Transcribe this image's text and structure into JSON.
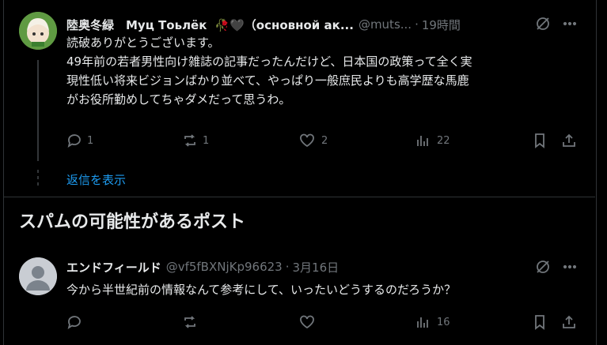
{
  "post1": {
    "display_name": "陸奥冬緑　Муц Тоьлёк",
    "emoji_suffix": "🥀🖤（основной ак...",
    "handle": "@muts...",
    "time": "19時間",
    "text_lines": [
      "読破ありがとうございます。",
      "49年前の若者男性向け雑誌の記事だったんだけど、日本国の政策って全く実",
      "現性低い将来ビジョンばかり並べて、やっぱり一般庶民よりも高学歴な馬鹿",
      "がお役所勤めしてちゃダメだって思うわ。"
    ],
    "reply_count": "1",
    "repost_count": "1",
    "like_count": "2",
    "view_count": "22"
  },
  "show_replies": "返信を表示",
  "spam_section_title": "スパムの可能性があるポスト",
  "post2": {
    "display_name": "エンドフィールド",
    "handle": "@vf5fBXNjKp96623",
    "time": "3月16日",
    "text": "今から半世紀前の情報なんて参考にして、いったいどうするのだろうか？",
    "view_count": "16"
  },
  "icons": {
    "reply": "reply-icon",
    "repost": "repost-icon",
    "like": "heart-icon",
    "views": "views-icon",
    "bookmark": "bookmark-icon",
    "share": "share-icon",
    "grok": "grok-icon",
    "more": "more-icon"
  }
}
